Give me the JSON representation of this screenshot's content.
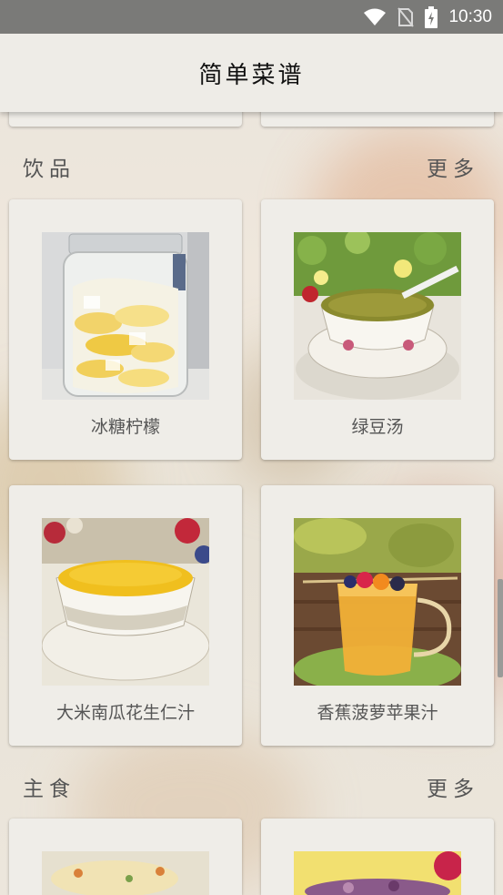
{
  "status_bar": {
    "time": "10:30"
  },
  "app_bar": {
    "title": "简单菜谱"
  },
  "sections": [
    {
      "title": "饮品",
      "more_label": "更多",
      "items": [
        {
          "name": "冰糖柠檬"
        },
        {
          "name": "绿豆汤"
        },
        {
          "name": "大米南瓜花生仁汁"
        },
        {
          "name": "香蕉菠萝苹果汁"
        }
      ]
    },
    {
      "title": "主食",
      "more_label": "更多"
    }
  ]
}
